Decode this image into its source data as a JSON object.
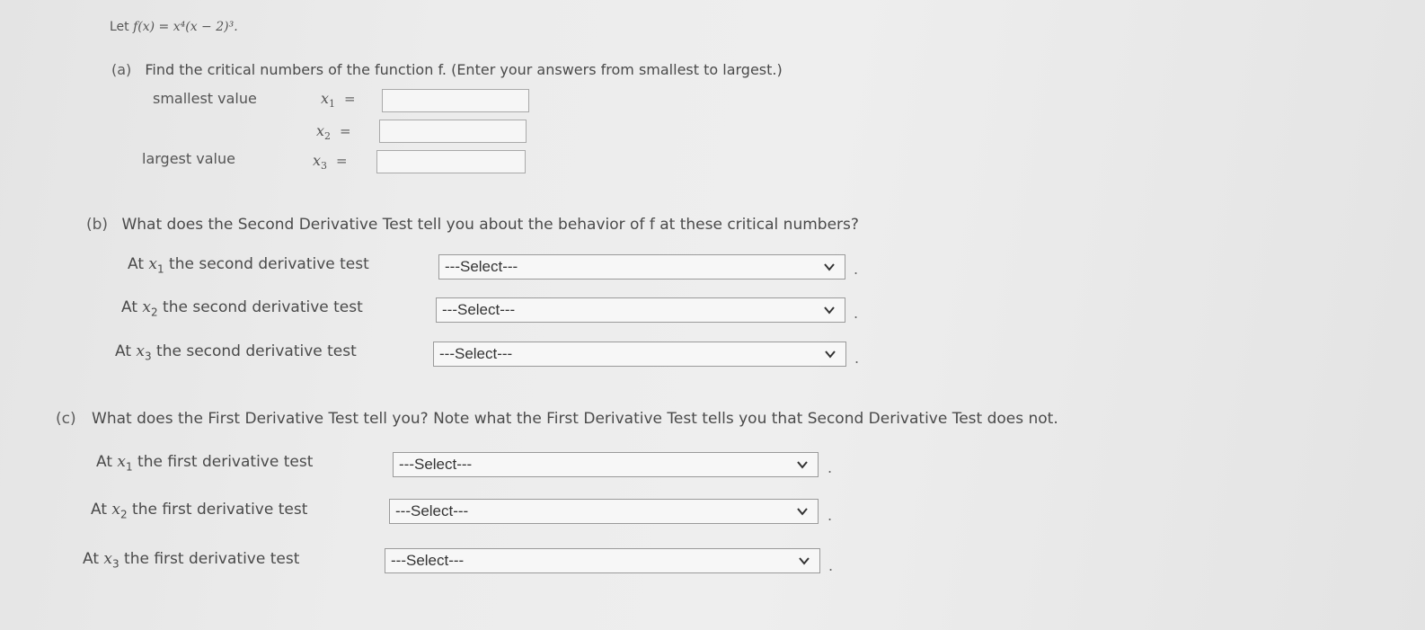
{
  "problem": {
    "prefix": "Let ",
    "expression": "f(x) = x⁴(x − 2)³."
  },
  "part_a": {
    "label": "(a)",
    "question": "Find the critical numbers of the function f. (Enter your answers from smallest to largest.)",
    "rows": [
      {
        "label": "smallest value",
        "var": "x",
        "sub": "1",
        "eq": "=",
        "value": ""
      },
      {
        "label": "",
        "var": "x",
        "sub": "2",
        "eq": "=",
        "value": ""
      },
      {
        "label": "largest value",
        "var": "x",
        "sub": "3",
        "eq": "=",
        "value": ""
      }
    ]
  },
  "part_b": {
    "label": "(b)",
    "question": "What does the Second Derivative Test tell you about the behavior of f at these critical numbers?",
    "rows": [
      {
        "prefix": "At ",
        "var": "x",
        "sub": "1",
        "suffix": " the second derivative test",
        "selected": "---Select---"
      },
      {
        "prefix": "At ",
        "var": "x",
        "sub": "2",
        "suffix": " the second derivative test",
        "selected": "---Select---"
      },
      {
        "prefix": "At ",
        "var": "x",
        "sub": "3",
        "suffix": " the second derivative test",
        "selected": "---Select---"
      }
    ]
  },
  "part_c": {
    "label": "(c)",
    "question": "What does the First Derivative Test tell you? Note what the First Derivative Test tells you that Second Derivative Test does not.",
    "rows": [
      {
        "prefix": "At ",
        "var": "x",
        "sub": "1",
        "suffix": " the first derivative test",
        "selected": "---Select---"
      },
      {
        "prefix": "At ",
        "var": "x",
        "sub": "2",
        "suffix": " the first derivative test",
        "selected": "---Select---"
      },
      {
        "prefix": "At ",
        "var": "x",
        "sub": "3",
        "suffix": " the first derivative test",
        "selected": "---Select---"
      }
    ]
  },
  "trailing_period": "."
}
